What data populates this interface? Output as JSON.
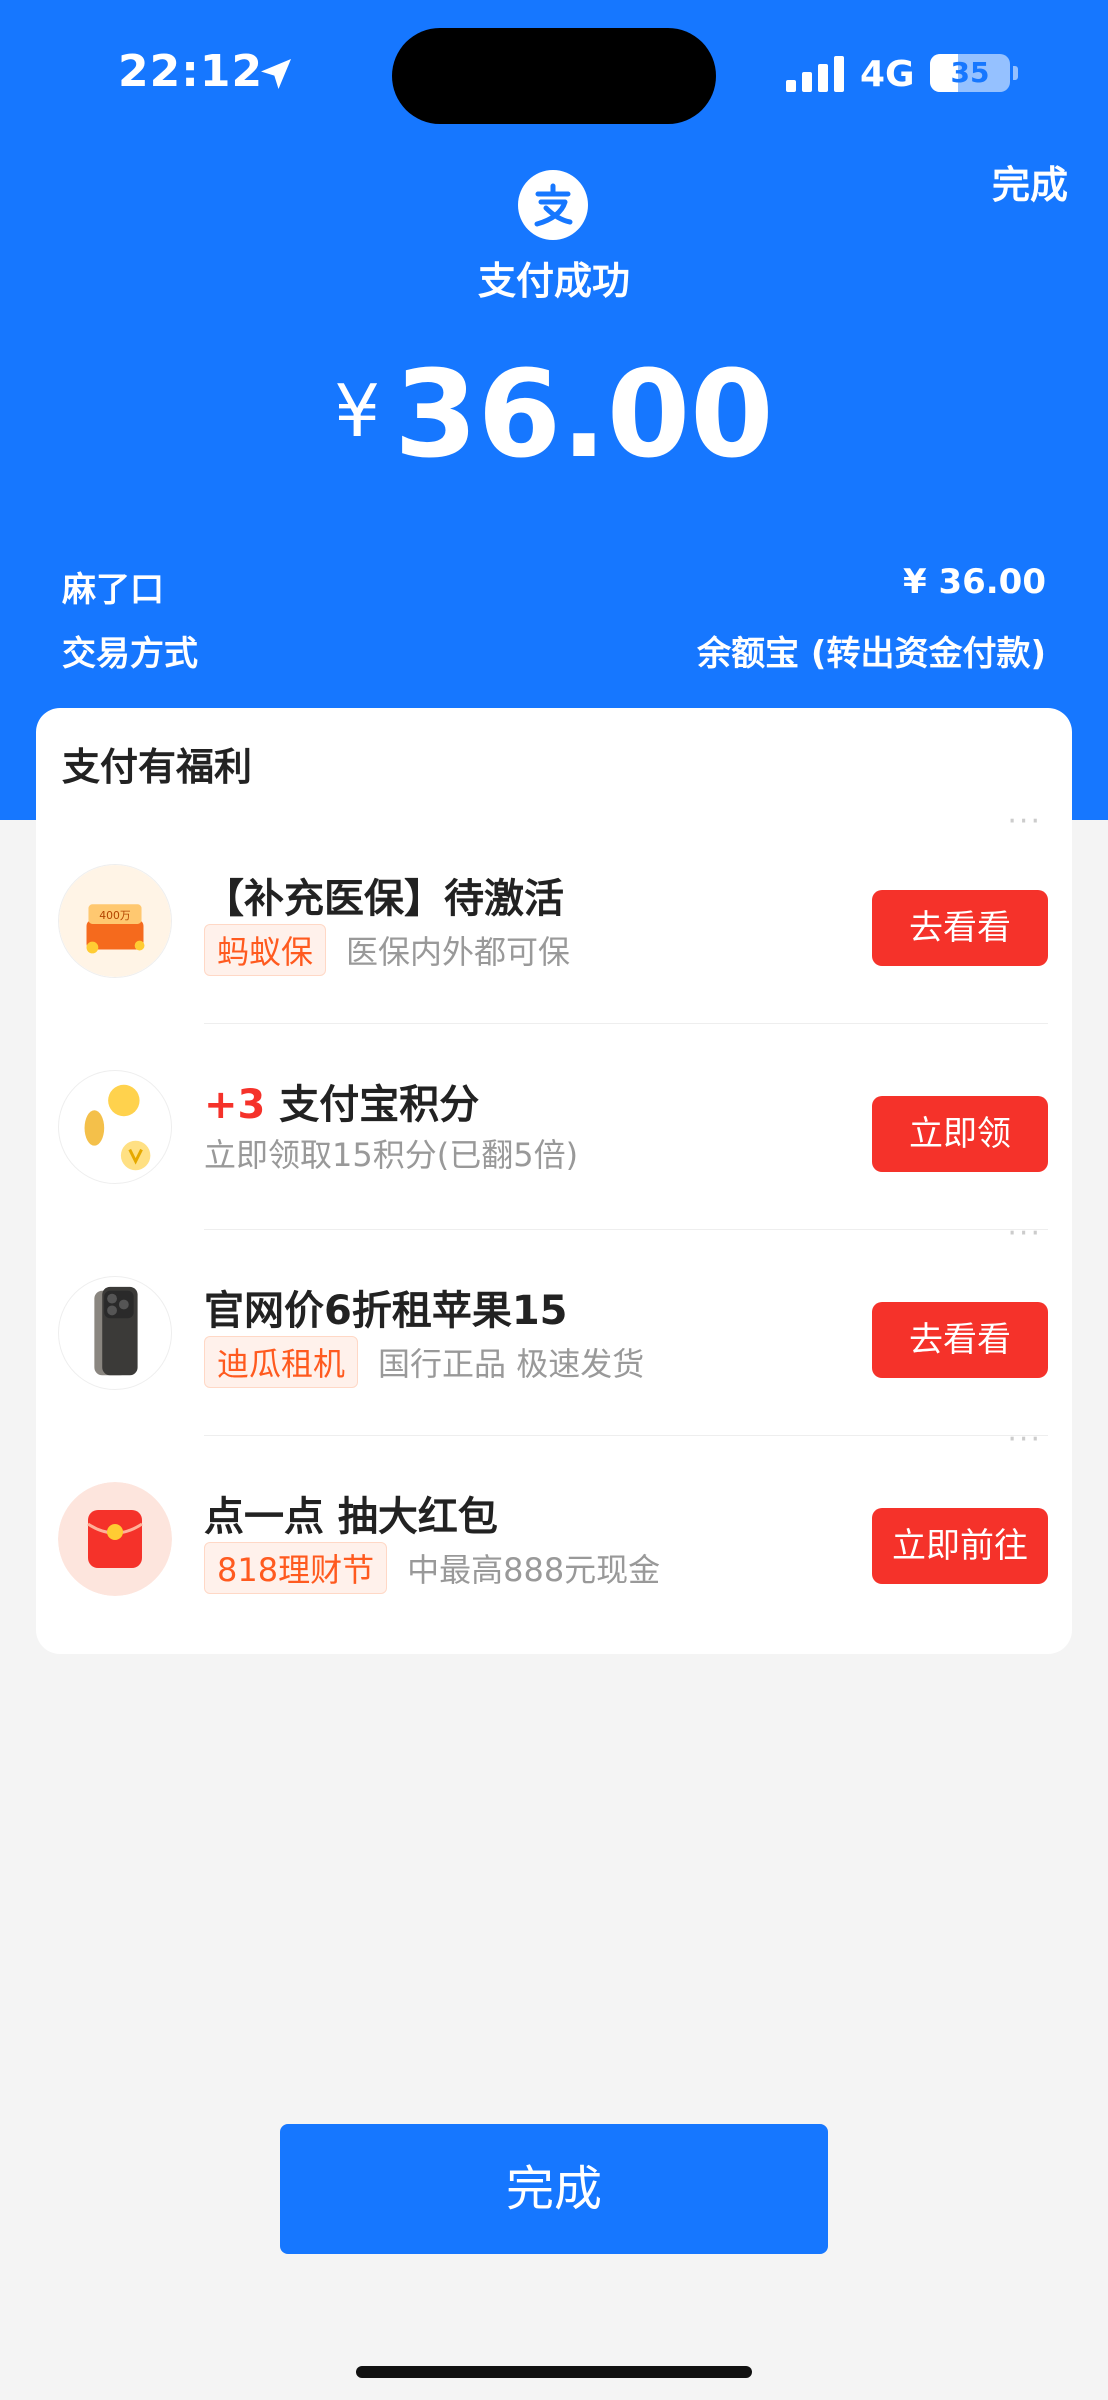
{
  "status_bar": {
    "time": "22:12",
    "network": "4G",
    "battery": "35",
    "battery_level": 0.35
  },
  "header": {
    "done_label": "完成",
    "title": "支付成功",
    "currency": "¥",
    "amount": "36.00"
  },
  "details": [
    {
      "label": "麻了口",
      "value": "¥ 36.00"
    },
    {
      "label": "交易方式",
      "value": "余额宝 (转出资金付款)"
    }
  ],
  "benefits": {
    "title": "支付有福利",
    "items": [
      {
        "title": "【补充医保】待激活",
        "tag": "蚂蚁保",
        "desc": "医保内外都可保",
        "button": "去看看",
        "thumb_text": "400万"
      },
      {
        "title_highlight": "+3",
        "title": "支付宝积分",
        "desc": "立即领取15积分(已翻5倍)",
        "button": "立即领"
      },
      {
        "title": "官网价6折租苹果15",
        "tag": "迪瓜租机",
        "desc": "国行正品 极速发货",
        "button": "去看看"
      },
      {
        "title": "点一点 抽大红包",
        "tag": "818理财节",
        "desc": "中最高888元现金",
        "button": "立即前往"
      }
    ]
  },
  "footer": {
    "done_label": "完成"
  },
  "colors": {
    "primary": "#1677ff",
    "accent_red": "#f5322a",
    "tag_orange": "#ff5a1f"
  }
}
